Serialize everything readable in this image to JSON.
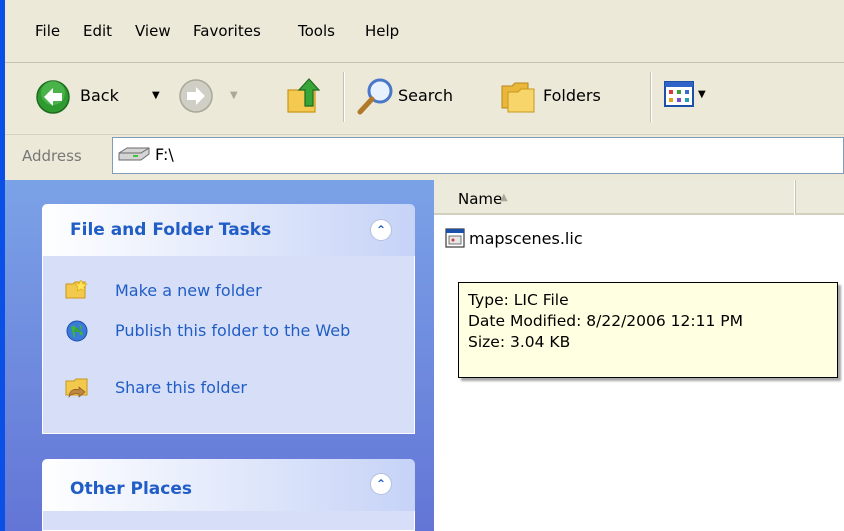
{
  "menu": {
    "items": [
      "File",
      "Edit",
      "View",
      "Favorites",
      "Tools",
      "Help"
    ]
  },
  "toolbar": {
    "back_label": "Back",
    "search_label": "Search",
    "folders_label": "Folders"
  },
  "address": {
    "label": "Address",
    "value": "F:\\"
  },
  "task_pane": {
    "file_folder_tasks": {
      "title": "File and Folder Tasks",
      "links": [
        "Make a new folder",
        "Publish this folder to the Web",
        "Share this folder"
      ]
    },
    "other_places": {
      "title": "Other Places"
    }
  },
  "file_list": {
    "column_name": "Name",
    "files": [
      {
        "name": "mapscenes.lic"
      }
    ]
  },
  "tooltip": {
    "type": "Type: LIC File",
    "date_modified": "Date Modified: 8/22/2006 12:11 PM",
    "size": "Size: 3.04 KB"
  },
  "colors": {
    "task_pane_gradient_top": "#7ba2e7",
    "task_pane_link": "#215dc6",
    "tooltip_bg": "#ffffe1"
  }
}
